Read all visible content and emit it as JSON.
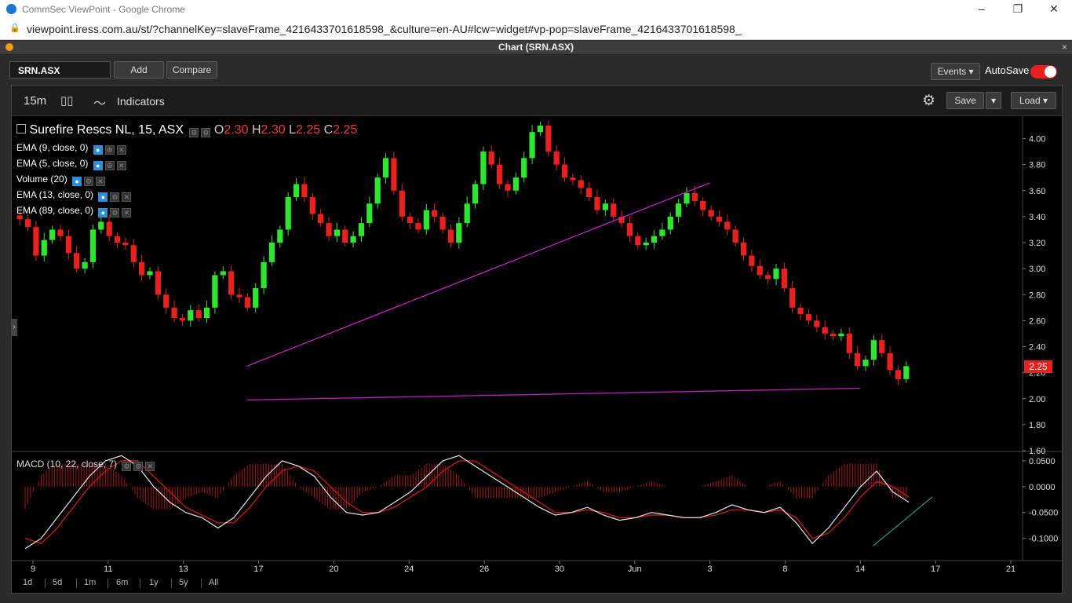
{
  "window": {
    "title": "CommSec ViewPoint - Google Chrome",
    "minimize": "–",
    "restore": "❐",
    "close": "✕"
  },
  "browser": {
    "lock": "🔒",
    "url": "viewpoint.iress.com.au/st/?channelKey=slaveFrame_4216433701618598_&culture=en-AU#lcw=widget#vp-pop=slaveFrame_4216433701618598_"
  },
  "panel": {
    "title": "Chart (SRN.ASX)",
    "close": "×"
  },
  "toolbar": {
    "symbol": "SRN.ASX",
    "add_label": "Add",
    "compare_label": "Compare",
    "events_label": "Events ▾",
    "autosave_label": "AutoSave"
  },
  "chart_toolbar": {
    "timeframe": "15m",
    "candle_icon": "▯▯",
    "indicators_icon": "〜",
    "indicators_label": "Indicators",
    "gear_icon": "⚙",
    "save_label": "Save",
    "save_caret": "▾",
    "load_label": "Load ▾"
  },
  "legend": {
    "instrument": "Surefire Rescs NL, 15, ASX",
    "o_label": "O",
    "o_value": "2.30",
    "h_label": "H",
    "h_value": "2.30",
    "l_label": "L",
    "l_value": "2.25",
    "c_label": "C",
    "c_value": "2.25",
    "studies": [
      "EMA (9, close, 0)",
      "EMA (5, close, 0)",
      "Volume (20)",
      "EMA (13, close, 0)",
      "EMA (89, close, 0)"
    ],
    "macd": "MACD (10, 22, close, 7)"
  },
  "last_price_tag": "2.25",
  "colors": {
    "up": "#2ee62e",
    "down": "#e8211e",
    "trendline": "#c020c0",
    "macd_line": "#e8e8e8",
    "signal_line": "#c01818",
    "support_line": "#20a080"
  },
  "chart_data": {
    "type": "candlestick",
    "price_axis": {
      "ticks": [
        "4.00",
        "3.80",
        "3.60",
        "3.40",
        "3.20",
        "3.00",
        "2.80",
        "2.60",
        "2.40",
        "2.20",
        "2.00",
        "1.80",
        "1.60"
      ],
      "range": [
        1.6,
        4.16
      ]
    },
    "date_axis": {
      "ticks": [
        "9",
        "11",
        "13",
        "17",
        "20",
        "24",
        "26",
        "30",
        "Jun",
        "3",
        "8",
        "14",
        "17",
        "21"
      ]
    },
    "close_series": [
      3.38,
      3.32,
      3.1,
      3.22,
      3.3,
      3.25,
      3.12,
      3.0,
      3.05,
      3.3,
      3.36,
      3.25,
      3.2,
      3.18,
      3.05,
      2.95,
      2.98,
      2.8,
      2.7,
      2.62,
      2.6,
      2.68,
      2.62,
      2.7,
      2.95,
      2.98,
      2.8,
      2.78,
      2.7,
      2.85,
      3.05,
      3.2,
      3.3,
      3.55,
      3.65,
      3.55,
      3.42,
      3.35,
      3.25,
      3.3,
      3.2,
      3.25,
      3.35,
      3.5,
      3.7,
      3.85,
      3.6,
      3.4,
      3.35,
      3.3,
      3.45,
      3.4,
      3.3,
      3.2,
      3.35,
      3.5,
      3.65,
      3.9,
      3.8,
      3.65,
      3.6,
      3.7,
      3.85,
      4.05,
      4.1,
      3.9,
      3.8,
      3.7,
      3.68,
      3.62,
      3.55,
      3.45,
      3.5,
      3.4,
      3.35,
      3.25,
      3.18,
      3.2,
      3.25,
      3.3,
      3.4,
      3.5,
      3.58,
      3.52,
      3.45,
      3.4,
      3.36,
      3.3,
      3.2,
      3.1,
      3.02,
      2.95,
      2.92,
      3.0,
      2.85,
      2.7,
      2.65,
      2.6,
      2.55,
      2.5,
      2.48,
      2.5,
      2.35,
      2.25,
      2.3,
      2.45,
      2.35,
      2.22,
      2.15,
      2.25
    ],
    "trendlines": [
      {
        "from": [
          "3",
          3.66
        ],
        "to": [
          "17",
          2.25
        ],
        "color": "trendline"
      },
      {
        "from": [
          "14",
          2.08
        ],
        "to": [
          "17",
          1.99
        ],
        "color": "trendline"
      }
    ],
    "macd_axis": {
      "ticks": [
        "0.0500",
        "0.0000",
        "-0.0500",
        "-0.1000"
      ],
      "range": [
        -0.14,
        0.065
      ]
    },
    "macd_line": [
      -0.12,
      -0.1,
      -0.06,
      -0.02,
      0.02,
      0.05,
      0.06,
      0.04,
      0.0,
      -0.03,
      -0.05,
      -0.06,
      -0.08,
      -0.06,
      -0.02,
      0.02,
      0.05,
      0.04,
      0.02,
      -0.02,
      -0.05,
      -0.055,
      -0.05,
      -0.03,
      -0.01,
      0.02,
      0.05,
      0.06,
      0.04,
      0.02,
      0.0,
      -0.02,
      -0.04,
      -0.055,
      -0.05,
      -0.04,
      -0.055,
      -0.065,
      -0.06,
      -0.05,
      -0.055,
      -0.06,
      -0.06,
      -0.05,
      -0.035,
      -0.045,
      -0.05,
      -0.04,
      -0.07,
      -0.11,
      -0.08,
      -0.04,
      0.0,
      0.03,
      -0.01,
      -0.03
    ],
    "signal_line": [
      -0.1,
      -0.11,
      -0.08,
      -0.04,
      0.0,
      0.03,
      0.05,
      0.05,
      0.02,
      -0.01,
      -0.04,
      -0.055,
      -0.07,
      -0.07,
      -0.04,
      0.0,
      0.03,
      0.04,
      0.03,
      0.0,
      -0.03,
      -0.05,
      -0.05,
      -0.04,
      -0.02,
      0.0,
      0.03,
      0.05,
      0.05,
      0.03,
      0.01,
      -0.01,
      -0.03,
      -0.05,
      -0.05,
      -0.045,
      -0.05,
      -0.06,
      -0.06,
      -0.055,
      -0.055,
      -0.06,
      -0.06,
      -0.055,
      -0.045,
      -0.045,
      -0.05,
      -0.045,
      -0.06,
      -0.1,
      -0.09,
      -0.06,
      -0.02,
      0.01,
      0.0,
      -0.02
    ],
    "macd_support_line": {
      "from": [
        0.86,
        -0.115
      ],
      "to": [
        1.0,
        -0.02
      ],
      "color": "support_line"
    }
  },
  "periods": [
    "1d",
    "5d",
    "1m",
    "6m",
    "1y",
    "5y",
    "All"
  ],
  "side_handle": "›"
}
